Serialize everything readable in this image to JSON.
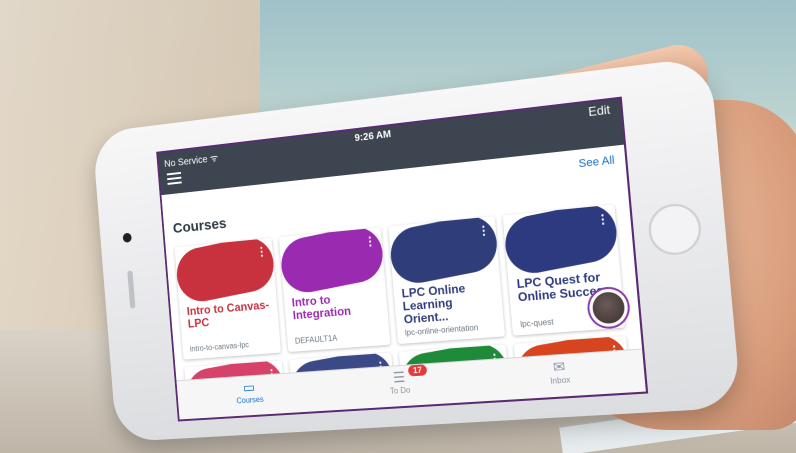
{
  "status": {
    "carrier": "No Service",
    "time": "9:26 AM"
  },
  "header": {
    "edit_label": "Edit"
  },
  "dashboard": {
    "see_all_label": "See All",
    "courses_heading": "Courses",
    "courses": [
      {
        "title": "Intro to Canvas-LPC",
        "code": "intro-to-canvas-lpc",
        "color": "#c8323f"
      },
      {
        "title": "Intro to Integration",
        "code": "DEFAULT1A",
        "color": "#9a2bb0"
      },
      {
        "title": "LPC Online Learning Orient...",
        "code": "lpc-online-orientation",
        "color": "#2f3e7a"
      },
      {
        "title": "LPC Quest for Online Success",
        "code": "lpc-quest",
        "color": "#2e3a7f"
      }
    ],
    "second_row_colors": [
      "#d6426a",
      "#3b4a86",
      "#1f8b3a",
      "#d6451f"
    ]
  },
  "tabs": {
    "courses": "Courses",
    "todo": "To Do",
    "inbox": "Inbox",
    "todo_badge": "17"
  },
  "icons": {
    "menu": "hamburger-menu-icon",
    "wifi": "wifi-icon",
    "dots": "more-vertical-icon",
    "courses_tab": "courses-tab-icon",
    "todo_tab": "todo-tab-icon",
    "inbox_tab": "inbox-envelope-icon"
  }
}
